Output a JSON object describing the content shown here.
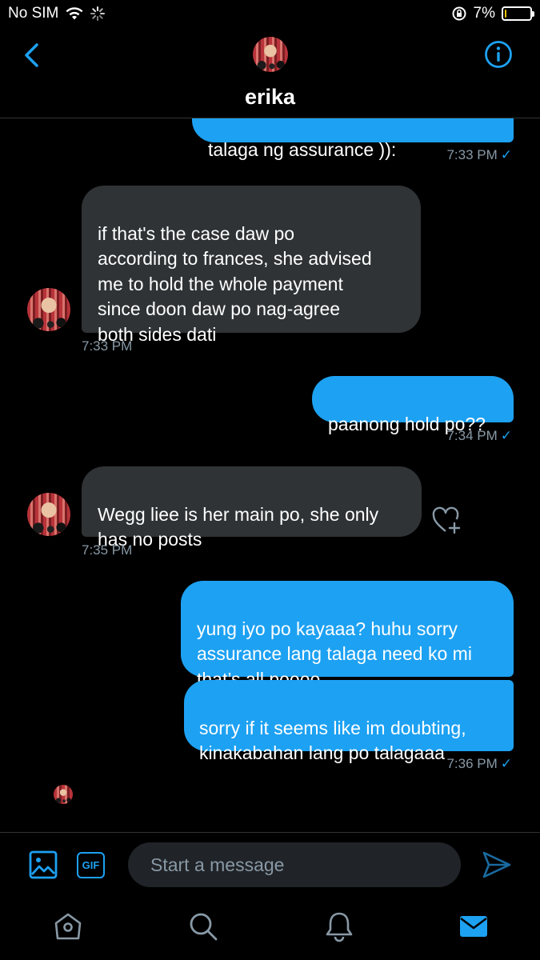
{
  "status_bar": {
    "carrier": "No SIM",
    "battery": "7%",
    "battery_level": 0.07,
    "colors": {
      "battery_fill": "#f5c400"
    }
  },
  "header": {
    "name": "erika",
    "back_icon": "chevron-left-icon",
    "info_icon": "info-icon"
  },
  "messages": [
    {
      "dir": "out",
      "text": "talaga ng assurance )):",
      "time": "7:33 PM",
      "read": true,
      "partial": true
    },
    {
      "dir": "in",
      "text": "if that's the case daw po\naccording to frances, she advised\nme to hold the whole payment\nsince doon daw po nag-agree\nboth sides dati",
      "time": "7:33 PM"
    },
    {
      "dir": "out",
      "text": "paanong hold po??",
      "time": "7:34 PM",
      "read": true
    },
    {
      "dir": "in",
      "text": "Wegg liee is her main po, she only\nhas no posts",
      "time": "7:35 PM"
    },
    {
      "dir": "out",
      "text": "yung iyo po kayaaa? huhu sorry\nassurance lang talaga need ko mi\nthat’s all poooo"
    },
    {
      "dir": "out",
      "text": "sorry if it seems like im doubting,\nkinakabahan lang po talagaaa",
      "time": "7:36 PM",
      "read": true
    }
  ],
  "composer": {
    "placeholder": "Start a message",
    "gif_label": "GIF",
    "media_icon": "image-icon",
    "send_icon": "send-icon"
  },
  "tabbar": {
    "items": [
      "home-icon",
      "search-icon",
      "notifications-icon",
      "messages-icon"
    ],
    "active": "messages-icon"
  },
  "colors": {
    "accent": "#1da1f2",
    "incoming_bubble": "#2f3336",
    "background": "#000000",
    "meta_text": "#8899a6"
  }
}
